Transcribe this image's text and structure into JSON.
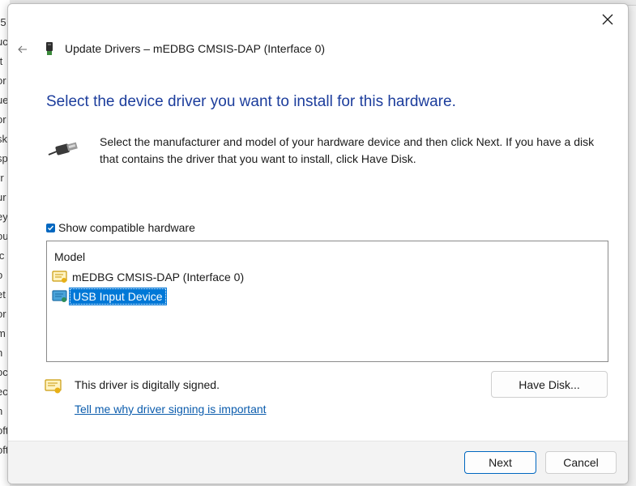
{
  "window": {
    "title": "Update Drivers – mEDBG CMSIS-DAP (Interface 0)"
  },
  "background_fragments": [
    "-5",
    "uc",
    "tt",
    "or",
    "ue",
    "or",
    "sk",
    "sp",
    "rr",
    "ur",
    "ey",
    "ou",
    "ic",
    "o",
    "et",
    "or",
    "m",
    "n",
    "oc",
    "ec",
    "n",
    "oft",
    "oft"
  ],
  "main": {
    "heading": "Select the device driver you want to install for this hardware.",
    "instructions": "Select the manufacturer and model of your hardware device and then click Next. If you have a disk that contains the driver that you want to install, click Have Disk.",
    "compatible": {
      "label": "Show compatible hardware",
      "checked": true
    },
    "model_list": {
      "header": "Model",
      "items": [
        {
          "label": "mEDBG CMSIS-DAP (Interface 0)",
          "selected": false
        },
        {
          "label": "USB Input Device",
          "selected": true
        }
      ]
    },
    "signing": {
      "status": "This driver is digitally signed.",
      "link": "Tell me why driver signing is important"
    },
    "have_disk_label": "Have Disk..."
  },
  "footer": {
    "next_label": "Next",
    "cancel_label": "Cancel"
  },
  "colors": {
    "heading": "#1c3d9c",
    "accent": "#0067c0",
    "selection": "#0078d7",
    "link": "#0b5cad"
  }
}
